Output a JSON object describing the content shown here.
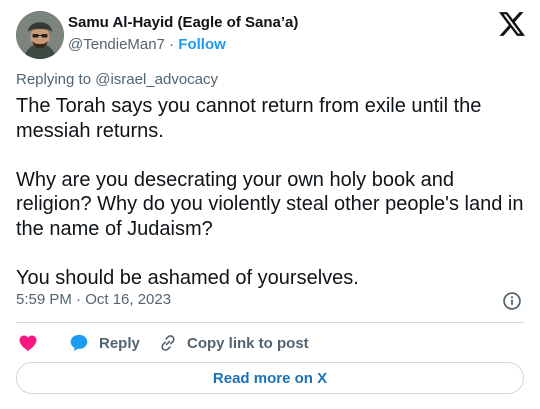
{
  "tweet": {
    "author": {
      "display_name": "Samu Al-Hayid (Eagle of Sana’a)",
      "handle": "@TendieMan7",
      "separator": "·",
      "follow_label": "Follow"
    },
    "replying_prefix": "Replying to ",
    "replying_to": "@israel_advocacy",
    "paragraphs": [
      "The Torah says you cannot return from exile until the messiah returns.",
      "Why are you desecrating your own holy book and religion? Why do you violently steal other people's land in the name of Judaism?",
      "You should be ashamed of yourselves."
    ],
    "timestamp": "5:59 PM · Oct 16, 2023"
  },
  "actions": {
    "like_icon": "heart-icon",
    "reply_label": "Reply",
    "reply_icon": "speech-bubble-icon",
    "copy_label": "Copy link to post",
    "copy_icon": "link-icon"
  },
  "read_more_label": "Read more on X",
  "icons": {
    "logo": "x-logo-icon",
    "info": "info-icon"
  },
  "colors": {
    "heart": "#f91880",
    "reply_bubble": "#1d9bf0",
    "link_blue": "#1d9bf0",
    "read_more_text": "#1d71b8",
    "secondary_text": "#536471",
    "primary_text": "#0f1419",
    "border": "#cfd9de"
  }
}
